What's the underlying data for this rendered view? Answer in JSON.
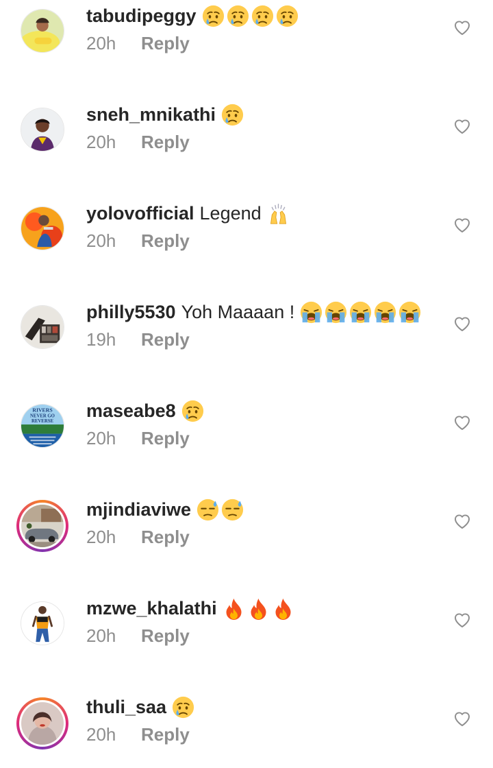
{
  "comments": [
    {
      "username": "tabudipeggy",
      "text": "",
      "emojis": [
        "sad-tear",
        "sad-tear",
        "sad-tear",
        "sad-tear"
      ],
      "time": "20h",
      "reply": "Reply",
      "avatar": "avatar-yellow"
    },
    {
      "username": "sneh_mnikathi",
      "text": "",
      "emojis": [
        "sad-tear"
      ],
      "time": "20h",
      "reply": "Reply",
      "avatar": "avatar-woman-purple"
    },
    {
      "username": "yolovofficial",
      "text": "Legend",
      "emojis": [
        "raised-hands"
      ],
      "time": "20h",
      "reply": "Reply",
      "avatar": "avatar-fire"
    },
    {
      "username": "philly5530",
      "text": "Yoh Maaaan !",
      "emojis": [
        "loud-cry",
        "loud-cry",
        "loud-cry",
        "loud-cry",
        "loud-cry"
      ],
      "time": "19h",
      "reply": "Reply",
      "avatar": "avatar-shelf"
    },
    {
      "username": "maseabe8",
      "text": "",
      "emojis": [
        "sad-tear"
      ],
      "time": "20h",
      "reply": "Reply",
      "avatar": "avatar-rivers-sign"
    },
    {
      "username": "mjindiaviwe",
      "text": "",
      "emojis": [
        "downcast-sweat",
        "downcast-sweat"
      ],
      "time": "20h",
      "reply": "Reply",
      "avatar": "avatar-car-story"
    },
    {
      "username": "mzwe_khalathi",
      "text": "",
      "emojis": [
        "fire",
        "fire",
        "fire"
      ],
      "time": "20h",
      "reply": "Reply",
      "avatar": "avatar-man-standing"
    },
    {
      "username": "thuli_saa",
      "text": "",
      "emojis": [
        "sad-tear"
      ],
      "time": "20h",
      "reply": "Reply",
      "avatar": "avatar-woman-story"
    }
  ],
  "avatar_sign_text": [
    "RIVERS",
    "NEVER GO",
    "REVERSE"
  ],
  "colors": {
    "username": "#262626",
    "meta": "#8e8e8e",
    "heart_outline": "#8e8e8e",
    "emoji_yellow": "#ffcc4d",
    "emoji_tear": "#5dadec",
    "fire_red": "#f4511e",
    "fire_orange": "#ffb300"
  }
}
